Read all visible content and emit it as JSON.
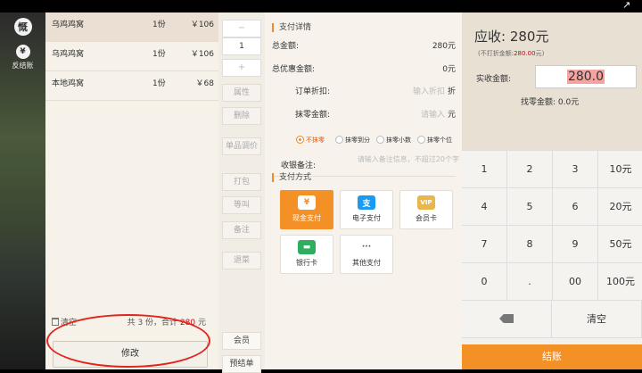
{
  "sidebar": {
    "items": [
      {
        "icon": "menu-card-icon",
        "glyph": "慨",
        "label": ""
      },
      {
        "icon": "yen-refund-icon",
        "glyph": "¥",
        "label": "反结账"
      }
    ]
  },
  "order": {
    "rows": [
      {
        "name": "乌鸡鸡窝",
        "qty": "1份",
        "price": "￥106"
      },
      {
        "name": "乌鸡鸡窝",
        "qty": "1份",
        "price": "￥106"
      },
      {
        "name": "本地鸡窝",
        "qty": "1份",
        "price": "￥68"
      }
    ],
    "clear_label": "清空",
    "summary_prefix": "共 3 份，合计",
    "summary_amount": "280",
    "summary_unit": "元",
    "modify_label": "修改"
  },
  "actions": {
    "minus": "−",
    "qty_value": "1",
    "plus": "+",
    "buttons": [
      "属性",
      "删除",
      "单品调价",
      "打包",
      "等叫",
      "备注",
      "退菜"
    ],
    "bottom_buttons": [
      "会员",
      "预结单"
    ]
  },
  "pay_details": {
    "title": "支付详情",
    "total_label": "总金额:",
    "total_value": "280元",
    "discount_label": "总优惠金额:",
    "discount_value": "0元",
    "order_discount_label": "订单折扣:",
    "order_discount_placeholder": "输入折扣",
    "order_discount_unit": "折",
    "rounding_label": "抹零金额:",
    "rounding_placeholder": "请输入",
    "rounding_unit": "元",
    "rounding_options": [
      "不抹零",
      "抹零到分",
      "抹零小数",
      "抹零个位"
    ],
    "note_label": "收银备注:",
    "note_placeholder": "请输入备注信息，不超过20个字",
    "method_title": "支付方式",
    "methods": [
      {
        "label": "现金支付",
        "icon": "cash-icon",
        "glyph": "¥",
        "active": true
      },
      {
        "label": "电子支付",
        "icon": "alipay-icon",
        "glyph": "支",
        "active": false
      },
      {
        "label": "会员卡",
        "icon": "vip-card-icon",
        "glyph": "VIP",
        "active": false
      },
      {
        "label": "银行卡",
        "icon": "bank-card-icon",
        "glyph": "▬",
        "active": false
      },
      {
        "label": "其他支付",
        "icon": "more-icon",
        "glyph": "···",
        "active": false
      }
    ]
  },
  "checkout": {
    "receivable_label": "应收:",
    "receivable_value": "280元",
    "no_discount_prefix": "(不打折金额:",
    "no_discount_value": "280.00",
    "no_discount_suffix": "元)",
    "received_label": "实收金额:",
    "received_value": "280.0",
    "change_label": "找零金额:",
    "change_value": "0.0元",
    "keys": [
      "1",
      "2",
      "3",
      "10元",
      "4",
      "5",
      "6",
      "20元",
      "7",
      "8",
      "9",
      "50元",
      "0",
      ".",
      "00",
      "100元"
    ],
    "clear_label": "清空",
    "submit_label": "结账"
  },
  "colors": {
    "accent": "#f39026",
    "alert": "#d0021b"
  }
}
